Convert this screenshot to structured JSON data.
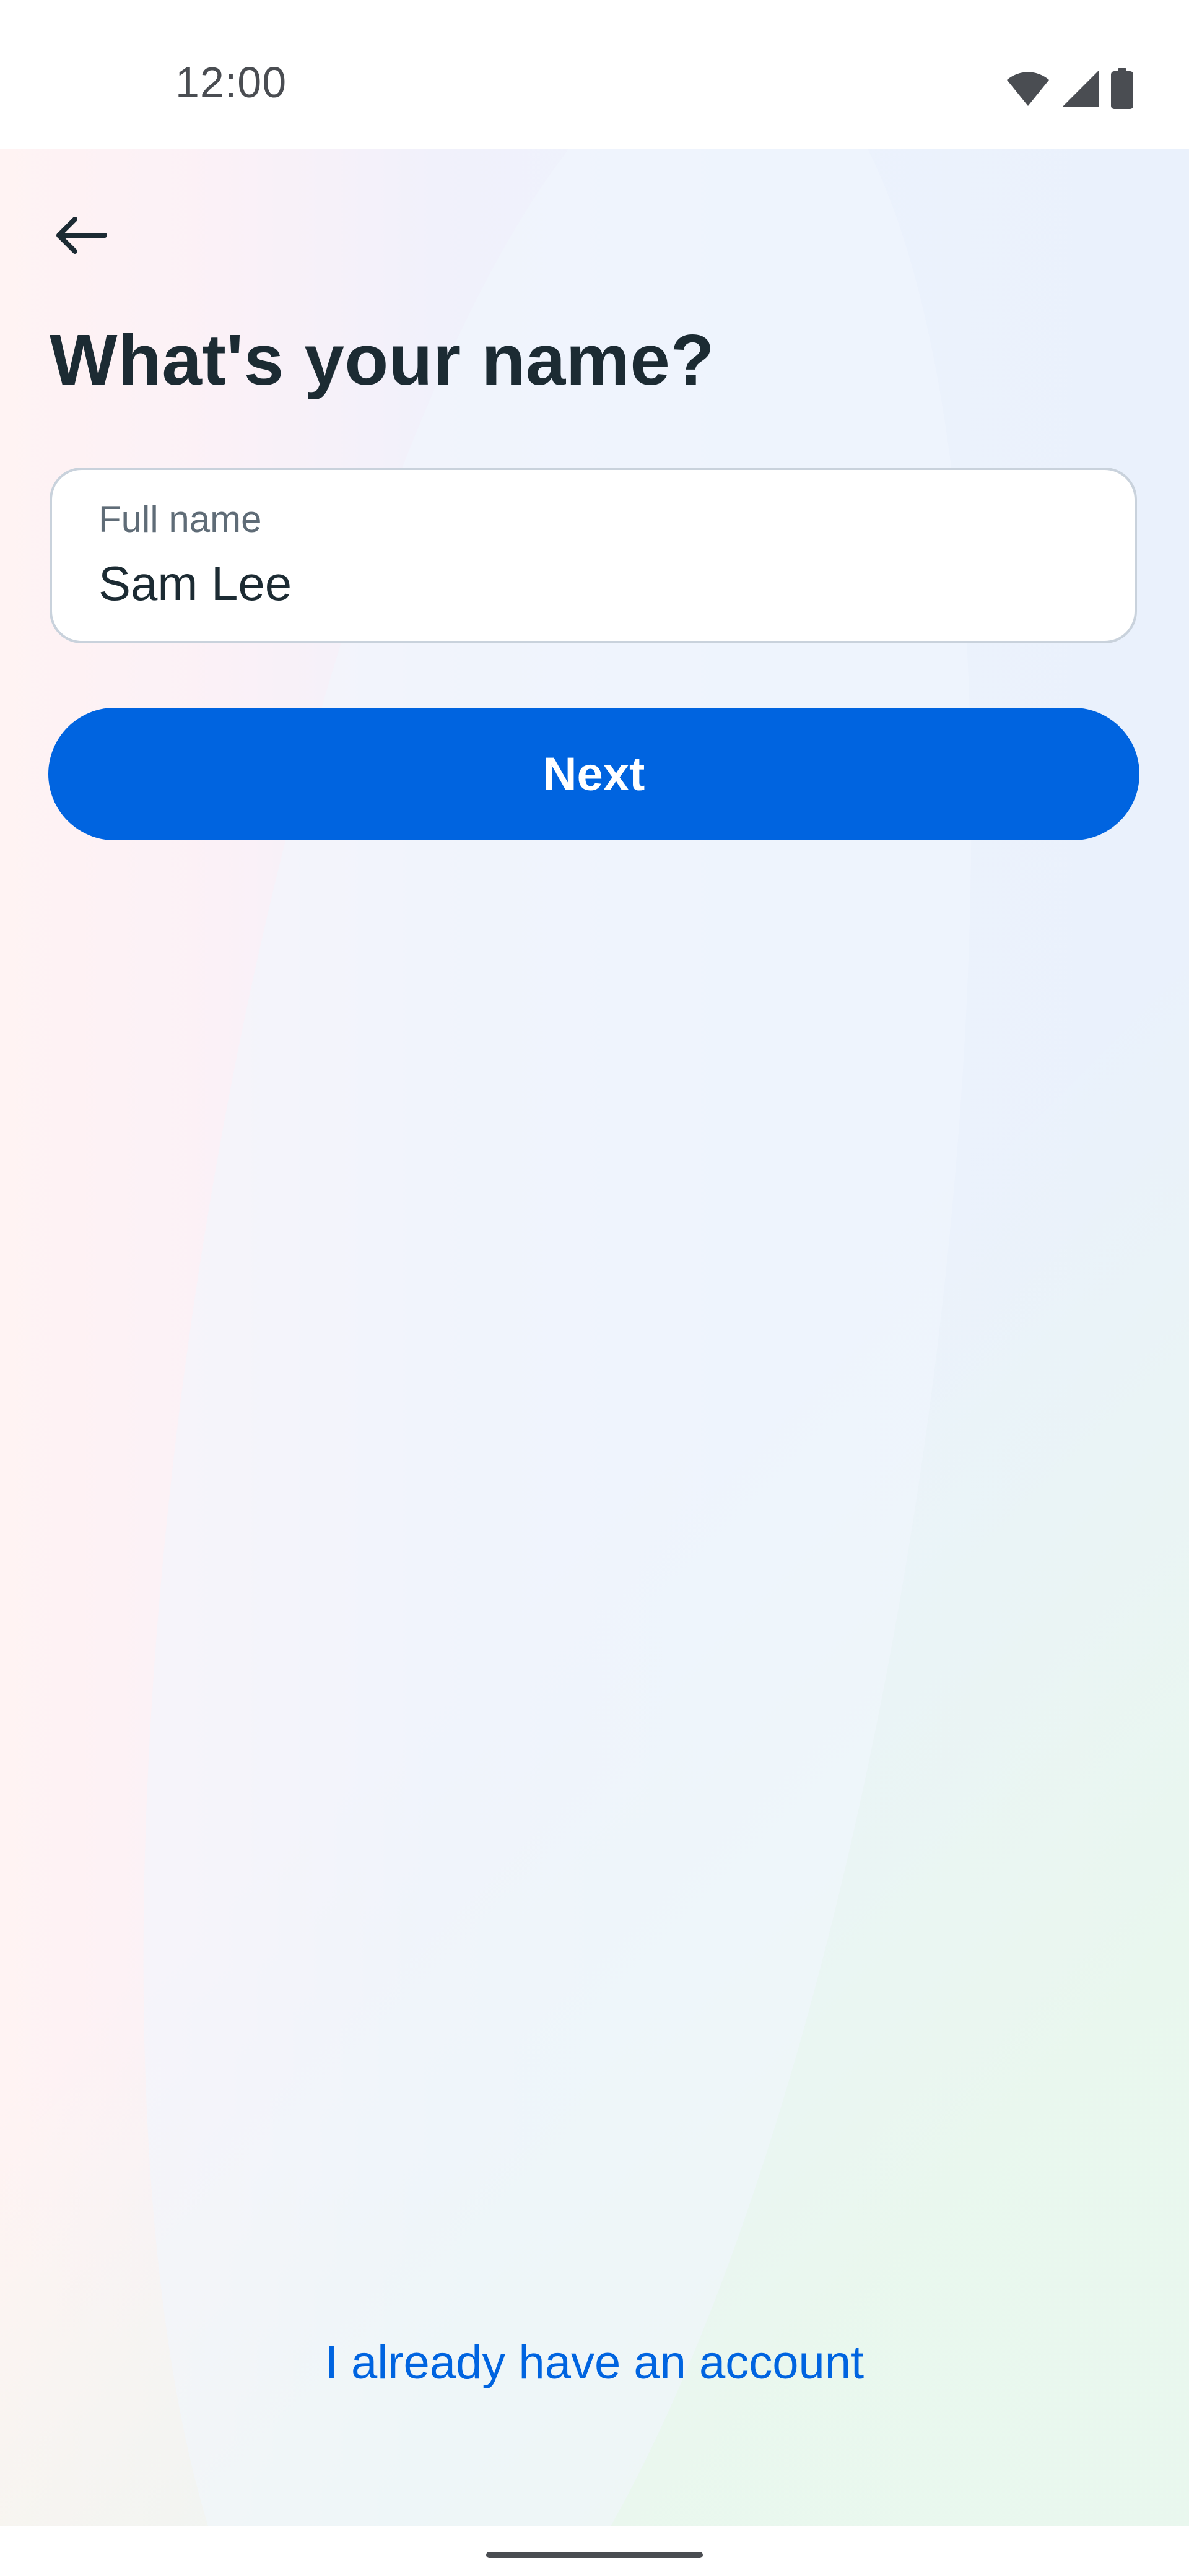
{
  "status_bar": {
    "time": "12:00",
    "icons": [
      "wifi-icon",
      "cellular-signal-icon",
      "battery-icon"
    ]
  },
  "nav": {
    "back_icon": "arrow-left-icon"
  },
  "page": {
    "title": "What's your name?"
  },
  "name_field": {
    "label": "Full name",
    "value": "Sam Lee"
  },
  "actions": {
    "next_label": "Next",
    "login_link": "I already have an account"
  },
  "colors": {
    "primary": "#0064e0",
    "title_text": "#1c2b33",
    "field_border": "#c9d2dc"
  }
}
